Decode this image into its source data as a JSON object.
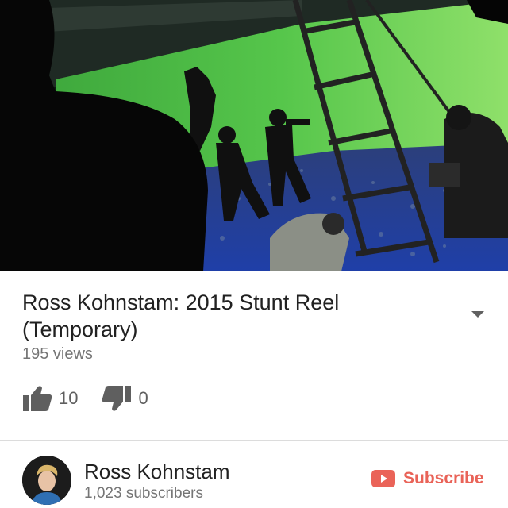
{
  "video": {
    "thumbnail": "green-screen-film-set"
  },
  "info": {
    "title": "Ross Kohnstam: 2015 Stunt Reel (Temporary)",
    "views": "195 views",
    "expand_icon": "chevron-down-icon",
    "like_icon": "thumbs-up-icon",
    "dislike_icon": "thumbs-down-icon",
    "likes": "10",
    "dislikes": "0"
  },
  "channel": {
    "name": "Ross Kohnstam",
    "subscribers": "1,023 subscribers",
    "subscribe_label": "Subscribe",
    "subscribe_icon": "youtube-play-icon"
  },
  "colors": {
    "accent": "#e6483b",
    "text_primary": "#212121",
    "text_secondary": "#757575",
    "green_screen": "#4fc04a"
  }
}
